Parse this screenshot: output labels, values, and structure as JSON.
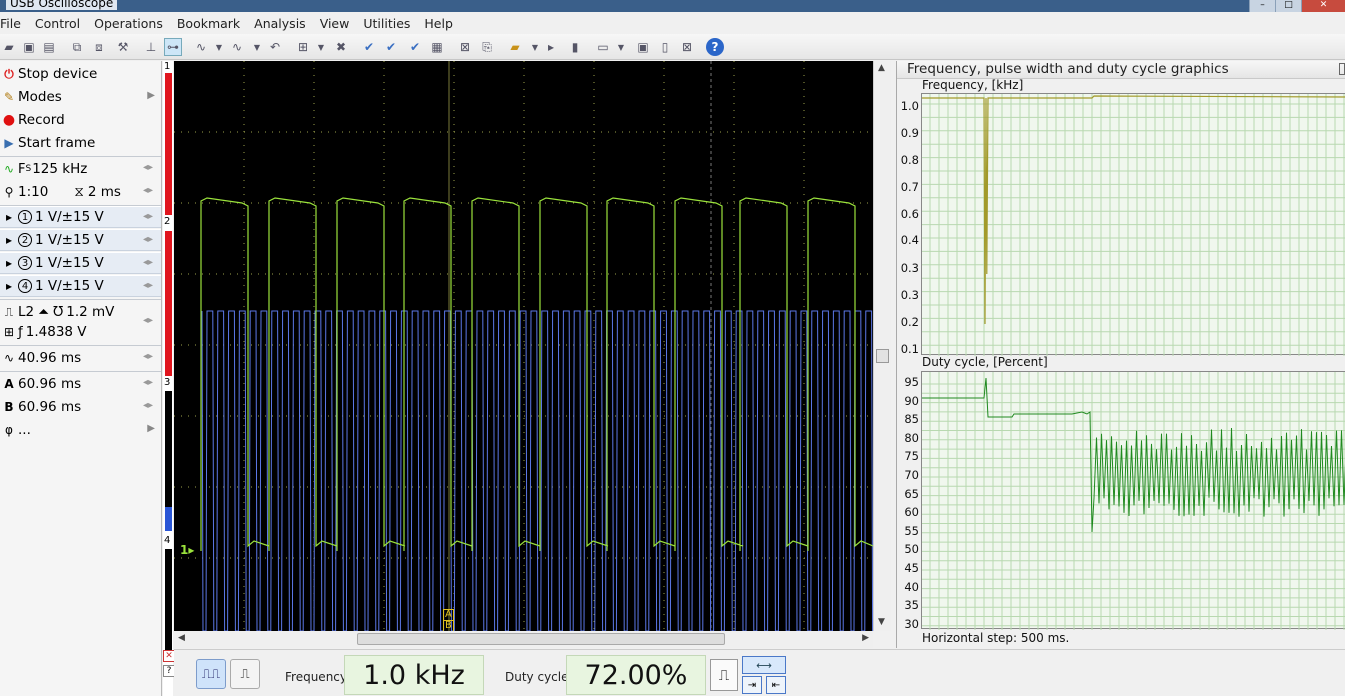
{
  "window": {
    "title": "USB Oscilloscope"
  },
  "menu": [
    "File",
    "Control",
    "Operations",
    "Bookmark",
    "Analysis",
    "View",
    "Utilities",
    "Help"
  ],
  "left_panel": {
    "stop_device": "Stop device",
    "modes": "Modes",
    "record": "Record",
    "start_frame": "Start frame",
    "sample_rate": "125 kHz",
    "zoom": "1:10",
    "timebase": "2 ms",
    "channels": [
      {
        "num": "1",
        "range": "1 V/±15 V"
      },
      {
        "num": "2",
        "range": "1 V/±15 V"
      },
      {
        "num": "3",
        "range": "1 V/±15 V"
      },
      {
        "num": "4",
        "range": "1 V/±15 V"
      }
    ],
    "trigger_channel": "L2",
    "trigger_level": "1.2 mV",
    "trigger_value": "1.4838 V",
    "time_span": "40.96 ms",
    "cursor_a": "60.96 ms",
    "cursor_b": "60.96 ms",
    "phase": "..."
  },
  "channel_strip": [
    "1",
    "2",
    "3",
    "4"
  ],
  "scope": {
    "channel_marker": "1▸",
    "cursor_a_label": "A",
    "cursor_b_label": "B"
  },
  "right_panel": {
    "title": "Frequency, pulse width and duty cycle graphics",
    "freq_label": "Frequency, [kHz]",
    "freq_ticks": [
      "1.0",
      "0.9",
      "0.8",
      "0.7",
      "0.6",
      "0.4",
      "0.3",
      "0.3",
      "0.2",
      "0.1"
    ],
    "duty_label": "Duty cycle, [Percent]",
    "duty_ticks": [
      "95",
      "90",
      "85",
      "80",
      "75",
      "70",
      "65",
      "60",
      "55",
      "50",
      "45",
      "40",
      "35",
      "30"
    ],
    "horizontal_step": "Horizontal step: 500 ms."
  },
  "bottom": {
    "frequency_label": "Frequency:",
    "frequency_value": "1.0 kHz",
    "duty_label": "Duty cycle:",
    "duty_value": "72.00%"
  },
  "colors": {
    "channel1": "#9be33c",
    "channel2": "#5c78e8",
    "grid": "#9aa04a",
    "duty_trace": "#1f8a1f",
    "freq_trace": "#a29a2a"
  }
}
